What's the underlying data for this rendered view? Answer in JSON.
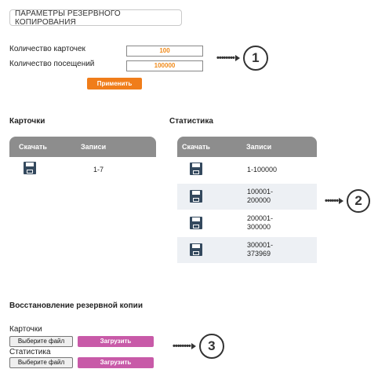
{
  "header": {
    "tab_label": "ПАРАМЕТРЫ РЕЗЕРВНОГО КОПИРОВАНИЯ"
  },
  "settings": {
    "cards_label": "Количество карточек",
    "cards_value": "100",
    "visits_label": "Количество посещений",
    "visits_value": "100000",
    "apply_label": "Применить"
  },
  "markers": {
    "one": "1",
    "two": "2",
    "three": "3"
  },
  "cards_section": {
    "title": "Карточки",
    "col_download": "Скачать",
    "col_records": "Записи",
    "rows": [
      {
        "records": "1-7"
      }
    ]
  },
  "stats_section": {
    "title": "Статистика",
    "col_download": "Скачать",
    "col_records": "Записи",
    "rows": [
      {
        "records_line1": "1-100000",
        "records_line2": ""
      },
      {
        "records_line1": "100001-",
        "records_line2": "200000"
      },
      {
        "records_line1": "200001-",
        "records_line2": "300000"
      },
      {
        "records_line1": "300001-",
        "records_line2": "373969"
      }
    ]
  },
  "restore": {
    "title": "Восстановление резервной копии",
    "cards_label": "Карточки",
    "stats_label": "Статистика",
    "choose_file_label": "Выберите файл",
    "upload_label": "Загрузить"
  },
  "colors": {
    "accent_orange": "#f07d1a",
    "upload_magenta": "#c85aa8",
    "table_header_gray": "#8d8d8d",
    "row_shade": "#edf0f4",
    "disk_icon": "#34495e"
  },
  "icons": {
    "download": "floppy-disk-icon"
  }
}
